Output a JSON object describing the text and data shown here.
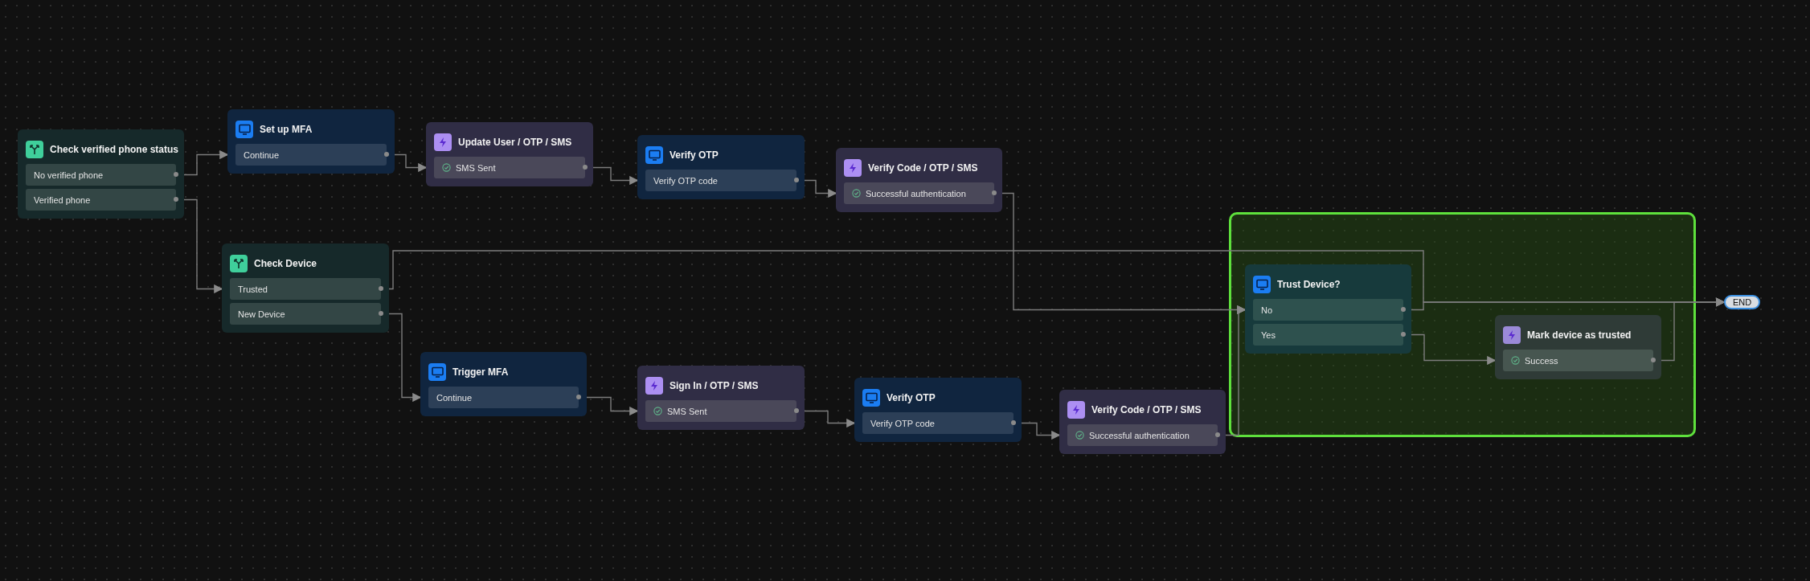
{
  "nodes": [
    {
      "kind": "branch",
      "title": "Check verified phone status",
      "outputs": [
        "No verified phone",
        "Verified phone"
      ]
    },
    {
      "kind": "screen",
      "title": "Set up MFA",
      "outputs": [
        "Continue"
      ]
    },
    {
      "kind": "action",
      "title": "Update User / OTP / SMS",
      "outputs": [
        "SMS Sent"
      ]
    },
    {
      "kind": "screen",
      "title": "Verify OTP",
      "outputs": [
        "Verify OTP code"
      ]
    },
    {
      "kind": "action",
      "title": "Verify Code / OTP / SMS",
      "outputs": [
        "Successful authentication"
      ]
    },
    {
      "kind": "branch",
      "title": "Check Device",
      "outputs": [
        "Trusted",
        "New Device"
      ]
    },
    {
      "kind": "screen",
      "title": "Trigger MFA",
      "outputs": [
        "Continue"
      ]
    },
    {
      "kind": "action",
      "title": "Sign In / OTP / SMS",
      "outputs": [
        "SMS Sent"
      ]
    },
    {
      "kind": "screen",
      "title": "Verify OTP",
      "outputs": [
        "Verify OTP code"
      ]
    },
    {
      "kind": "action",
      "title": "Verify Code / OTP / SMS",
      "outputs": [
        "Successful authentication"
      ]
    }
  ],
  "group": {
    "nodes": [
      {
        "kind": "screen",
        "title": "Trust Device?",
        "outputs": [
          "No",
          "Yes"
        ]
      },
      {
        "kind": "action",
        "title": "Mark device as trusted",
        "outputs": [
          "Success"
        ]
      }
    ]
  },
  "end_label": "END"
}
